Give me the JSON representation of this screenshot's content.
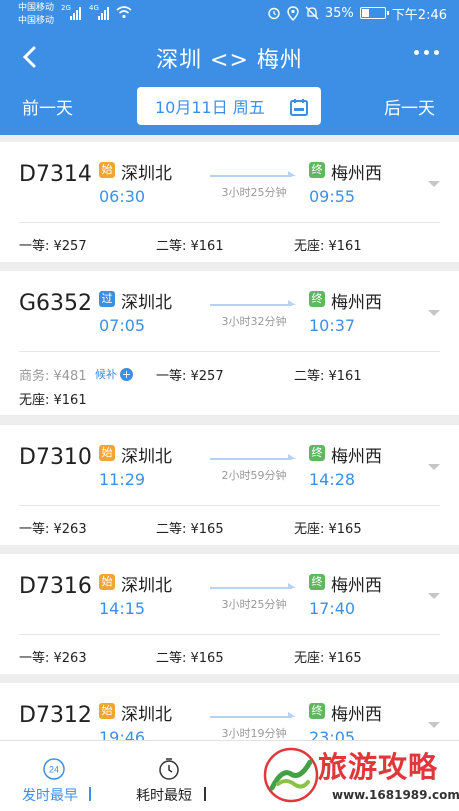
{
  "status_bar": {
    "carrier_1": "中国移动",
    "carrier_2": "中国移动",
    "net_1": "2G",
    "net_2": "4G",
    "battery": "35%",
    "battery_level": 0.35,
    "time": "下午2:46"
  },
  "header": {
    "title": "深圳 <> 梅州",
    "prev_day": "前一天",
    "date": "10月11日 周五",
    "next_day": "后一天"
  },
  "trains": [
    {
      "number": "D7314",
      "from_tag": "始",
      "from": "深圳北",
      "depart": "06:30",
      "duration": "3小时25分钟",
      "to_tag": "终",
      "to": "梅州西",
      "arrive": "09:55",
      "prices": [
        "一等: ¥257",
        "二等: ¥161",
        "无座: ¥161"
      ]
    },
    {
      "number": "G6352",
      "from_tag": "过",
      "from": "深圳北",
      "depart": "07:05",
      "duration": "3小时32分钟",
      "to_tag": "终",
      "to": "梅州西",
      "arrive": "10:37",
      "prices": [
        "商务: ¥481",
        "一等: ¥257",
        "二等: ¥161",
        "无座: ¥161"
      ],
      "waitlist": "候补",
      "waitlist_plus": "+"
    },
    {
      "number": "D7310",
      "from_tag": "始",
      "from": "深圳北",
      "depart": "11:29",
      "duration": "2小时59分钟",
      "to_tag": "终",
      "to": "梅州西",
      "arrive": "14:28",
      "prices": [
        "一等: ¥263",
        "二等: ¥165",
        "无座: ¥165"
      ]
    },
    {
      "number": "D7316",
      "from_tag": "始",
      "from": "深圳北",
      "depart": "14:15",
      "duration": "3小时25分钟",
      "to_tag": "终",
      "to": "梅州西",
      "arrive": "17:40",
      "prices": [
        "一等: ¥263",
        "二等: ¥165",
        "无座: ¥165"
      ]
    },
    {
      "number": "D7312",
      "from_tag": "始",
      "from": "深圳北",
      "depart": "19:46",
      "duration": "3小时19分钟",
      "to_tag": "终",
      "to": "梅州西",
      "arrive": "23:05"
    }
  ],
  "bottom_bar": {
    "sort_depart": "发时最早",
    "sort_depart_icon_text": "24",
    "sort_duration": "耗时最短"
  },
  "watermark": {
    "name": "旅游攻略",
    "url": "www.1681989.com"
  },
  "colors": {
    "primary": "#3d8fe6",
    "start_tag": "#f2a531",
    "end_tag": "#5fb760",
    "watermark": "#e0373b"
  }
}
